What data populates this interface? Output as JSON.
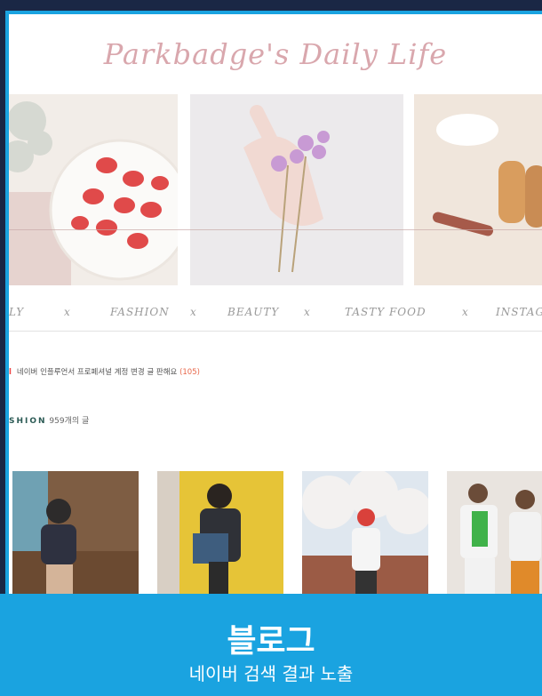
{
  "blog": {
    "title": "Parkbadge's Daily Life",
    "menu": [
      "LY",
      "x",
      "FASHION",
      "x",
      "BEAUTY",
      "x",
      "TASTY FOOD",
      "x",
      "INSTAGRA"
    ],
    "notice": {
      "mark": "l",
      "text": "네이버 인플루언서 프로페셔널 계정 변경 글 판해요",
      "count": "(105)"
    },
    "category": {
      "name": "SHION",
      "count": "959개의 글"
    }
  },
  "banner": {
    "title": "블로그",
    "subtitle": "네이버 검색 결과 노출"
  },
  "colors": {
    "accent": "#1aa3e0",
    "frame": "#1a2745"
  }
}
